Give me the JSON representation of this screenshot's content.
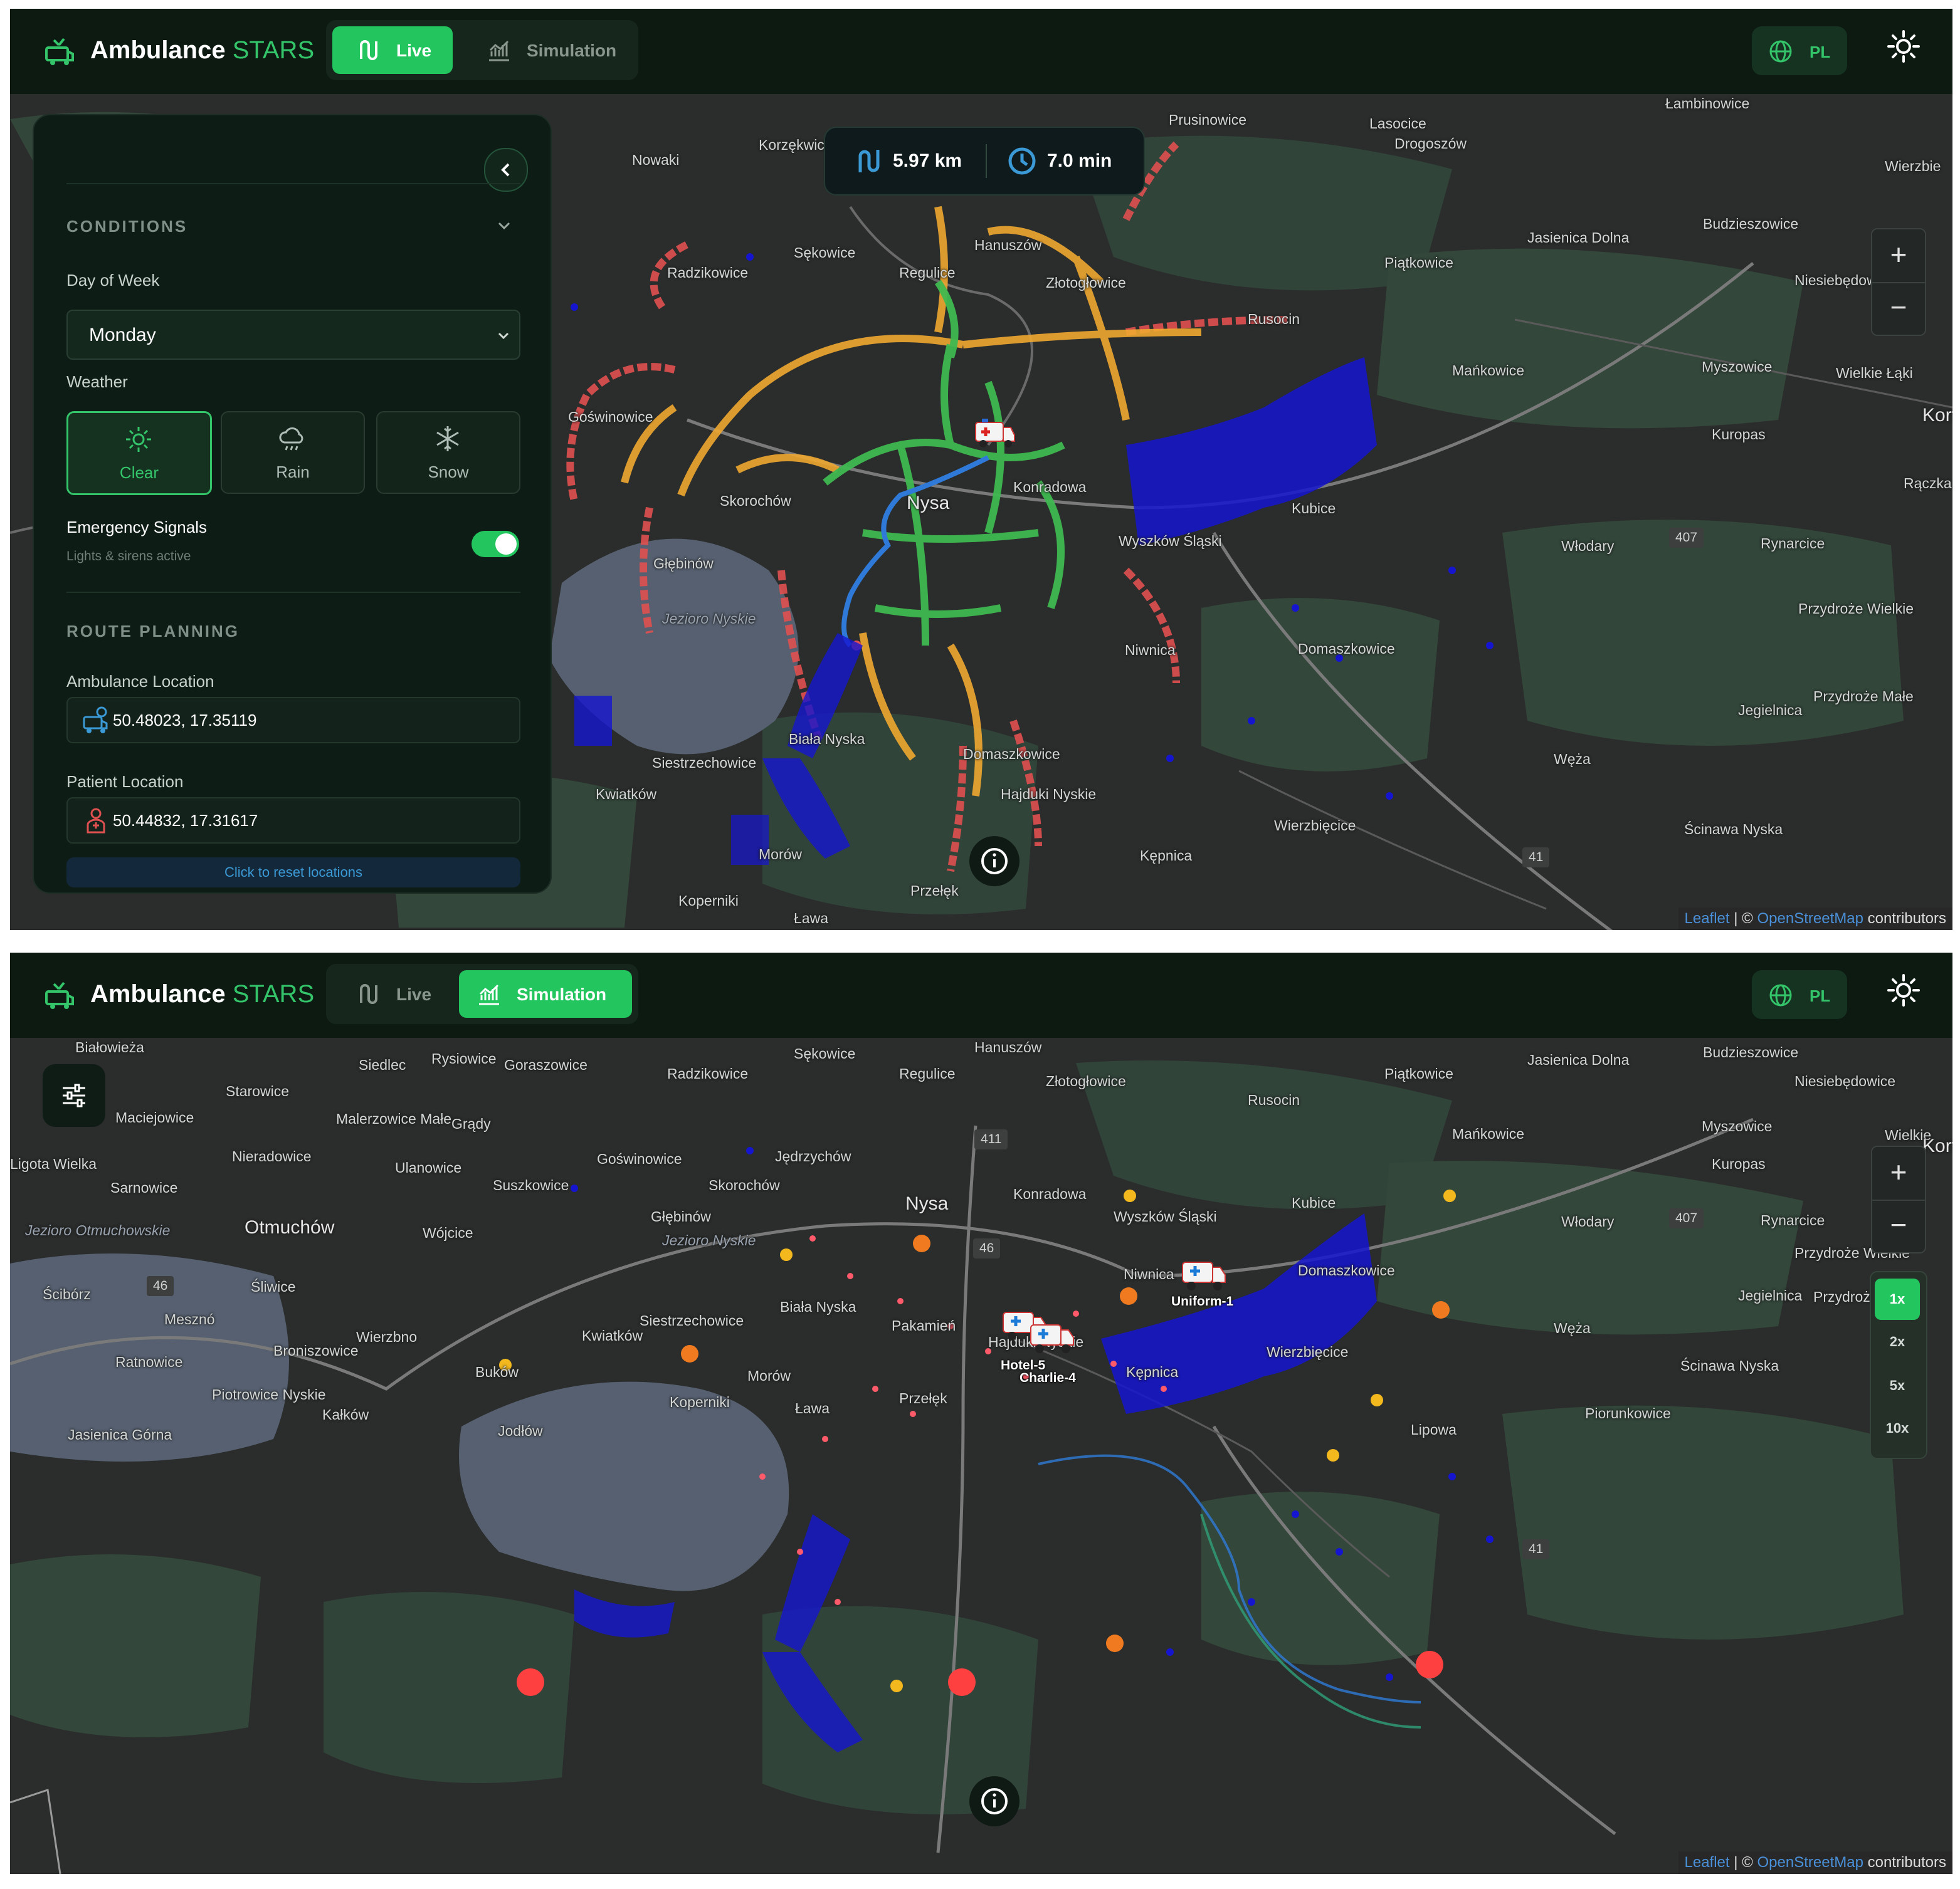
{
  "app": {
    "name": "Ambulance",
    "name_accent": "STARS"
  },
  "nav": {
    "live_label": "Live",
    "simulation_label": "Simulation",
    "language": "PL"
  },
  "colors": {
    "accent": "#22c55e",
    "background": "#0c1a12",
    "route_blue": "#3b82f6",
    "traffic_green": "#3fb950",
    "traffic_orange": "#f0a830",
    "traffic_red": "#e05050",
    "hotspot_blue": "#1515d0"
  },
  "live": {
    "active_tab": "Live",
    "route_summary": {
      "distance": "5.97 km",
      "duration": "7.0 min"
    },
    "panel": {
      "conditions_title": "CONDITIONS",
      "day_label": "Day of Week",
      "day_value": "Monday",
      "weather_label": "Weather",
      "weather_options": [
        {
          "label": "Clear",
          "icon": "sun-icon",
          "active": true
        },
        {
          "label": "Rain",
          "icon": "cloud-rain-icon",
          "active": false
        },
        {
          "label": "Snow",
          "icon": "snowflake-icon",
          "active": false
        }
      ],
      "signals_label": "Emergency Signals",
      "signals_hint": "Lights & sirens active",
      "signals_on": true,
      "route_planning_title": "ROUTE PLANNING",
      "ambulance_location_label": "Ambulance Location",
      "ambulance_location_value": "50.48023, 17.35119",
      "patient_location_label": "Patient Location",
      "patient_location_value": "50.44832, 17.31617",
      "reset_label": "Click to reset locations"
    },
    "places": [
      "Łambinowice",
      "Lasocice",
      "Prusinowice",
      "Drogoszów",
      "Wierzbie",
      "Nowaki",
      "Korzękwice",
      "Budzieszowice",
      "Jasienica Dolna",
      "Sękowice",
      "Hanuszów",
      "Piątkowice",
      "Niesiebędowice",
      "Radzikowice",
      "Regulice",
      "Złotogłowice",
      "Rusocin",
      "Mańkowice",
      "Myszowice",
      "Wielkie Łąki",
      "Goświnowice",
      "Kuropas",
      "Rączka",
      "Korf",
      "Konradowa",
      "Nysa",
      "Skorochów",
      "Kubice",
      "Wyszków Śląski",
      "Włodary",
      "Rynarcice",
      "Głębinów",
      "Przydroże Wielkie",
      "Jezioro Nyskie",
      "Niwnica",
      "Domaszkowice",
      "Przydroże Małe",
      "Jegielnica",
      "Siestrzechowice",
      "Biała Nyska",
      "Domaszkowice",
      "Węża",
      "Kwiatków",
      "Hajduki Nyskie",
      "Wierzbięcice",
      "Ścinawa Nyska",
      "Kępnica",
      "Morów",
      "Koperniki",
      "Przełęk",
      "Ława"
    ],
    "road_shields": [
      "407",
      "41"
    ]
  },
  "simulation": {
    "active_tab": "Simulation",
    "speed_options": [
      "1x",
      "2x",
      "5x",
      "10x"
    ],
    "speed_active": "1x",
    "units": [
      {
        "label": "Uniform-1"
      },
      {
        "label": "Hotel-5"
      },
      {
        "label": "Charlie-4"
      }
    ],
    "places": [
      "Białowieża",
      "Rysiowice",
      "Goraszowice",
      "Siedlec",
      "Starowice",
      "Maciejowice",
      "Malerzowice Małe",
      "Grądy",
      "Nieradowice",
      "Ligota Wielka",
      "Ulanowice",
      "Suszkowice",
      "Sarnowice",
      "Otmuchów",
      "Wójcice",
      "Jezioro Otmuchowskie",
      "Śliwice",
      "Ścibórz",
      "Mesznó",
      "Wierzbno",
      "Broniszowice",
      "Ratnowice",
      "Buków",
      "Piotrowice Nyskie",
      "Kałków",
      "Jasienica Górna",
      "Jodłów",
      "Przełęk",
      "Ława",
      "Koperniki",
      "Morów",
      "Lipowa",
      "Piorunkowice",
      "Ścinawa Nyska",
      "Wierzbięcice",
      "Kępnica",
      "Hajduki Nyskie",
      "Siestrzechowice",
      "Biała Nyska",
      "Kwiatków",
      "Jezioro Nyskie",
      "Głębinów",
      "Skorochów",
      "Jędrzychów",
      "Goświnowice",
      "Nysa",
      "Konradowa",
      "Wyszków Śląski",
      "Kubice",
      "Niwnica",
      "Domaszkowice",
      "Włodary",
      "Rynarcice",
      "Przydroże Wielkie",
      "Przydroże Małe",
      "Jegielnica",
      "Węża",
      "Kuropas",
      "Myszowice",
      "Mańkowice",
      "Piątkowice",
      "Budzieszowice",
      "Jasienica Dolna",
      "Niesiebędowice",
      "Rusocin",
      "Złotogłowice",
      "Regulice",
      "Hanuszów",
      "Sękowice",
      "Radzikowice",
      "Wielkie",
      "Korf",
      "Pakamień"
    ],
    "road_shields": [
      "411",
      "407",
      "41",
      "46",
      "46"
    ]
  },
  "map_ui": {
    "zoom_in": "+",
    "zoom_out": "−",
    "attribution_leaflet": "Leaflet",
    "attribution_sep": " | © ",
    "attribution_osm": "OpenStreetMap",
    "attribution_tail": " contributors"
  }
}
